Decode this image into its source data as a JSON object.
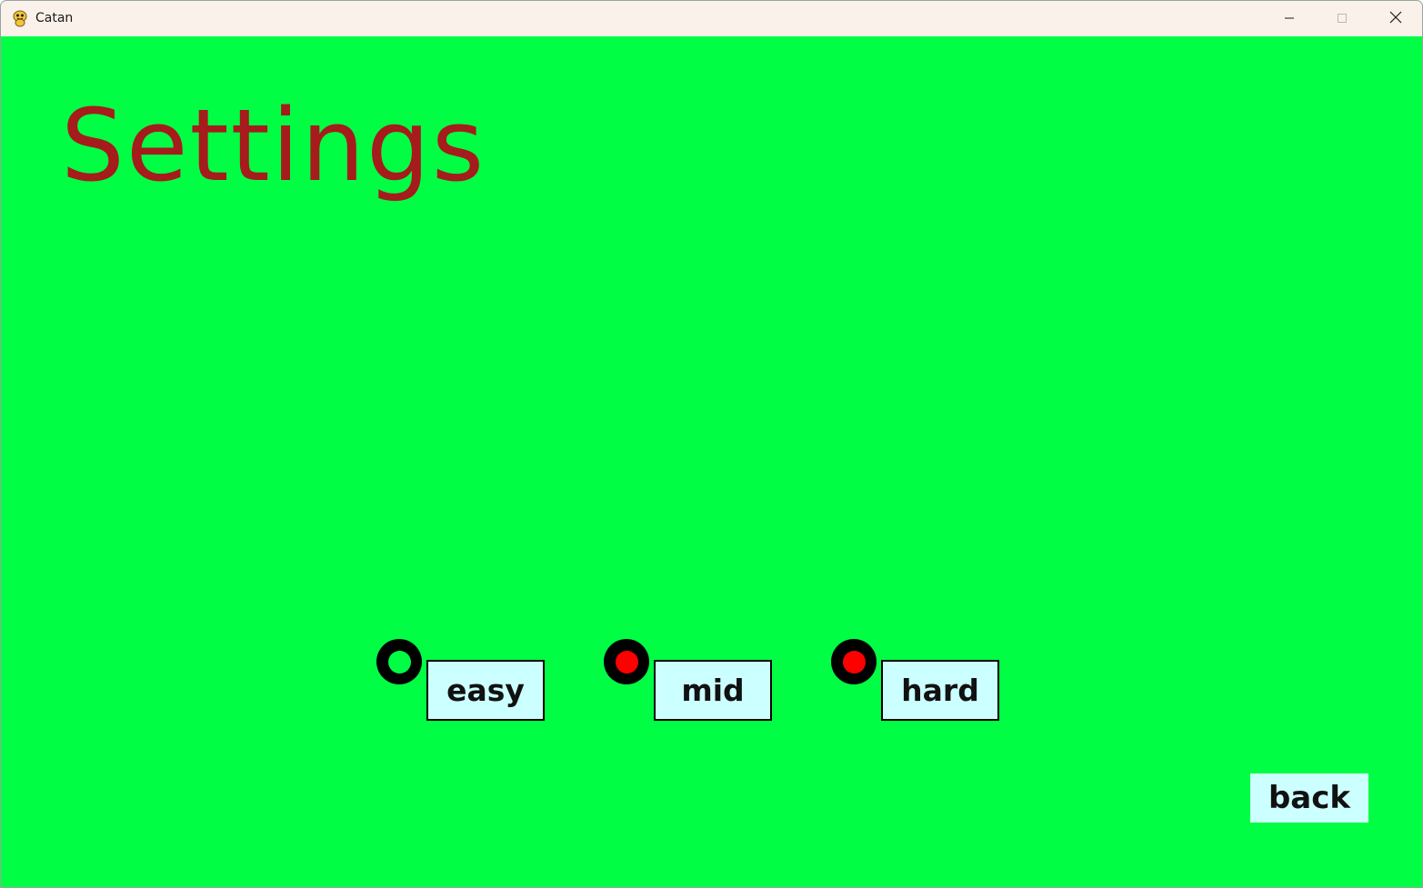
{
  "window": {
    "title": "Catan",
    "app_icon": "python-snake-icon",
    "controls": {
      "minimize_icon": "minimize-icon",
      "maximize_icon": "maximize-icon",
      "close_icon": "close-icon"
    }
  },
  "page": {
    "heading": "Settings",
    "background_color": "#00ff44",
    "heading_color": "#a61b1b"
  },
  "difficulty": {
    "options": [
      {
        "label": "easy",
        "selected": true,
        "indicator_color": "#00ff44"
      },
      {
        "label": "mid",
        "selected": false,
        "indicator_color": "#ff0000"
      },
      {
        "label": "hard",
        "selected": false,
        "indicator_color": "#ff0000"
      }
    ],
    "button_color": "#ccffff"
  },
  "back_button": {
    "label": "back"
  }
}
